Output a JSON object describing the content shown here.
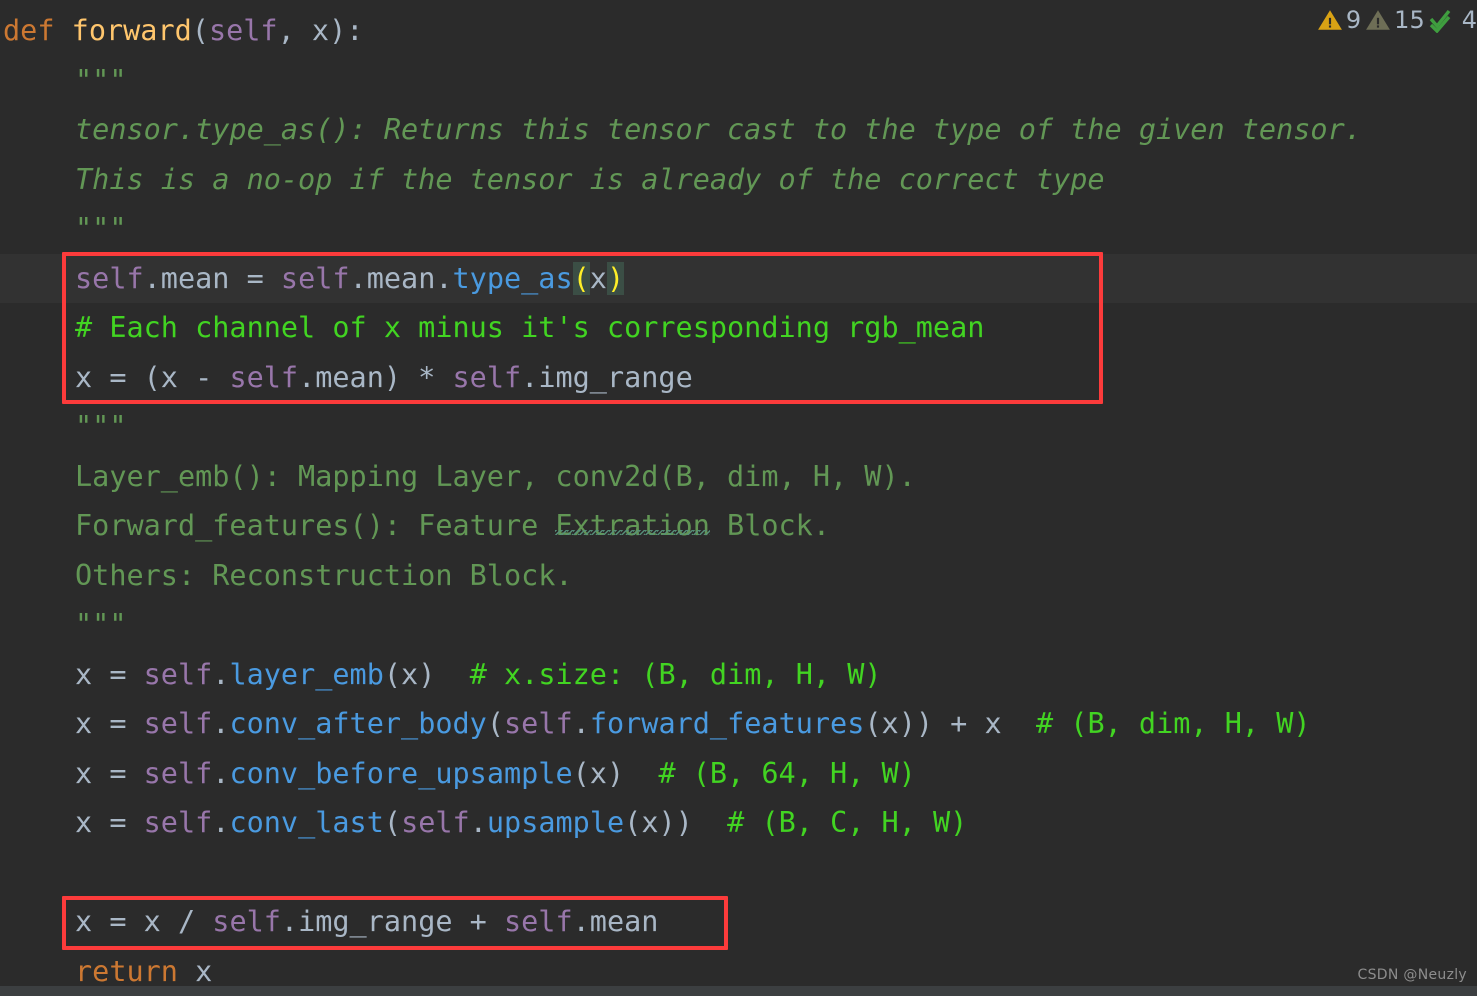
{
  "editor": {
    "background": "#2b2b2b",
    "current_line_background": "#323232",
    "language": "Python"
  },
  "inspection_widget": {
    "warnings_label": "9",
    "weak_warnings_label": "15",
    "typos_label": "4",
    "warning_icon": "warning-triangle-icon",
    "weak_warning_icon": "weak-warning-triangle-icon",
    "ok_icon": "double-check-icon",
    "warning_color": "#d9a214",
    "weak_warning_color": "#6e6e56",
    "ok_color": "#3f9e3f"
  },
  "colors": {
    "keyword": "#cc7832",
    "function_name": "#ffc66d",
    "self_keyword": "#9876aa",
    "method_call": "#4a9ae0",
    "identifier": "#a9b7c6",
    "comment": "#42d422",
    "docstring": "#629755",
    "matched_bracket_fg": "#ffef28",
    "matched_bracket_bg": "#3b4e45",
    "annotation_box": "#fc3b3b",
    "spellcheck_squiggle": "#57917b"
  },
  "annotations": [
    {
      "name": "highlight-box-normalization",
      "color": "#fc3b3b"
    },
    {
      "name": "highlight-box-denormalization",
      "color": "#fc3b3b"
    }
  ],
  "code": {
    "line_01": {
      "kw": "def",
      "fn": "forward",
      "p1": "(",
      "self": "self",
      "p2": ", ",
      "x": "x",
      "p3": "):"
    },
    "line_02": {
      "doc": "\"\"\""
    },
    "line_03": {
      "doc": "tensor.type_as(): Returns this tensor cast to the type of the given tensor."
    },
    "line_04": {
      "doc": "This is a no-op if the tensor is already of the correct type"
    },
    "line_05": {
      "doc": "\"\"\""
    },
    "line_06": {
      "self1": "self",
      "a1": ".mean = ",
      "self2": "self",
      "a2": ".mean.",
      "meth": "type_as",
      "open": "(",
      "arg": "x",
      "close": ")"
    },
    "line_07": {
      "comment": "# Each channel of x minus it's corresponding rgb_mean"
    },
    "line_08": {
      "pre": "x = (x - ",
      "self": "self",
      "mid": ".mean) * ",
      "self2": "self",
      "post": ".img_range"
    },
    "line_09": {
      "doc": "\"\"\""
    },
    "line_10": {
      "doc": "Layer_emb(): Mapping Layer, conv2d(B, dim, H, W)."
    },
    "line_11a": {
      "doc": "Forward_features(): Feature "
    },
    "line_11b": {
      "doc_typo": "Extration"
    },
    "line_11c": {
      "doc": " Block."
    },
    "line_12": {
      "doc": "Others: Reconstruction Block."
    },
    "line_13": {
      "doc": "\"\"\""
    },
    "line_14": {
      "pre": "x = ",
      "self": "self",
      "dot": ".",
      "meth": "layer_emb",
      "args": "(x)",
      "gap": "  ",
      "comment": "# x.size: (B, dim, H, W)"
    },
    "line_15": {
      "pre": "x = ",
      "self": "self",
      "dot": ".",
      "meth": "conv_after_body",
      "open": "(",
      "self2": "self",
      "dot2": ".",
      "meth2": "forward_features",
      "args": "(x))",
      "plus": " + x",
      "gap": "  ",
      "comment": "# (B, dim, H, W)"
    },
    "line_16": {
      "pre": "x = ",
      "self": "self",
      "dot": ".",
      "meth": "conv_before_upsample",
      "args": "(x)",
      "gap": "  ",
      "comment": "# (B, 64, H, W)"
    },
    "line_17": {
      "pre": "x = ",
      "self": "self",
      "dot": ".",
      "meth": "conv_last",
      "open": "(",
      "self2": "self",
      "dot2": ".",
      "meth2": "upsample",
      "args": "(x))",
      "gap": "  ",
      "comment": "# (B, C, H, W)"
    },
    "line_18": {
      "blank": " "
    },
    "line_19": {
      "pre": "x = x / ",
      "self": "self",
      "mid": ".img_range + ",
      "self2": "self",
      "post": ".mean"
    },
    "line_20": {
      "kw": "return",
      "var": " x"
    }
  },
  "watermark": {
    "text": "CSDN @Neuzly"
  }
}
